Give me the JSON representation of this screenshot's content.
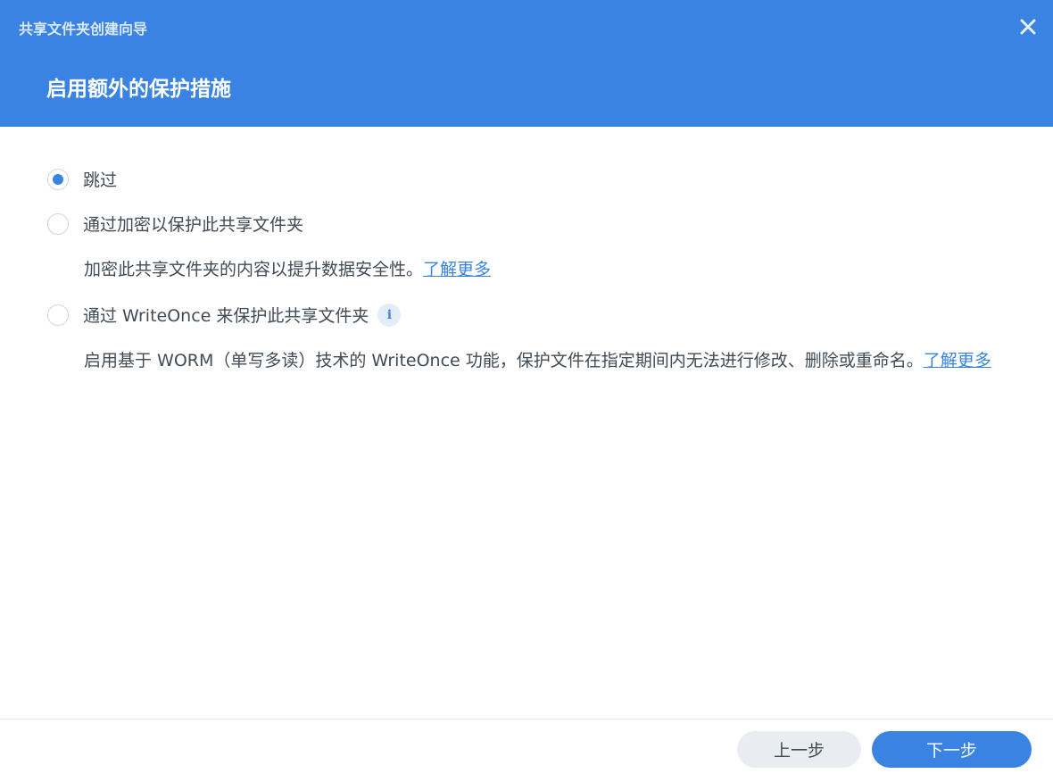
{
  "window": {
    "title": "共享文件夹创建向导"
  },
  "step": {
    "title": "启用额外的保护措施"
  },
  "options": [
    {
      "label": "跳过",
      "checked": true
    },
    {
      "label": "通过加密以保护此共享文件夹",
      "checked": false,
      "description": "加密此共享文件夹的内容以提升数据安全性。",
      "link": "了解更多"
    },
    {
      "label": "通过 WriteOnce 来保护此共享文件夹",
      "checked": false,
      "description": "启用基于 WORM（单写多读）技术的 WriteOnce 功能，保护文件在指定期间内无法进行修改、删除或重命名。",
      "link": "了解更多"
    }
  ],
  "buttons": {
    "prev": "上一步",
    "next": "下一步"
  },
  "colors": {
    "accent": "#3a83e3",
    "text": "#414b55"
  },
  "icons": {
    "close": "close-icon",
    "info": "info-icon"
  }
}
